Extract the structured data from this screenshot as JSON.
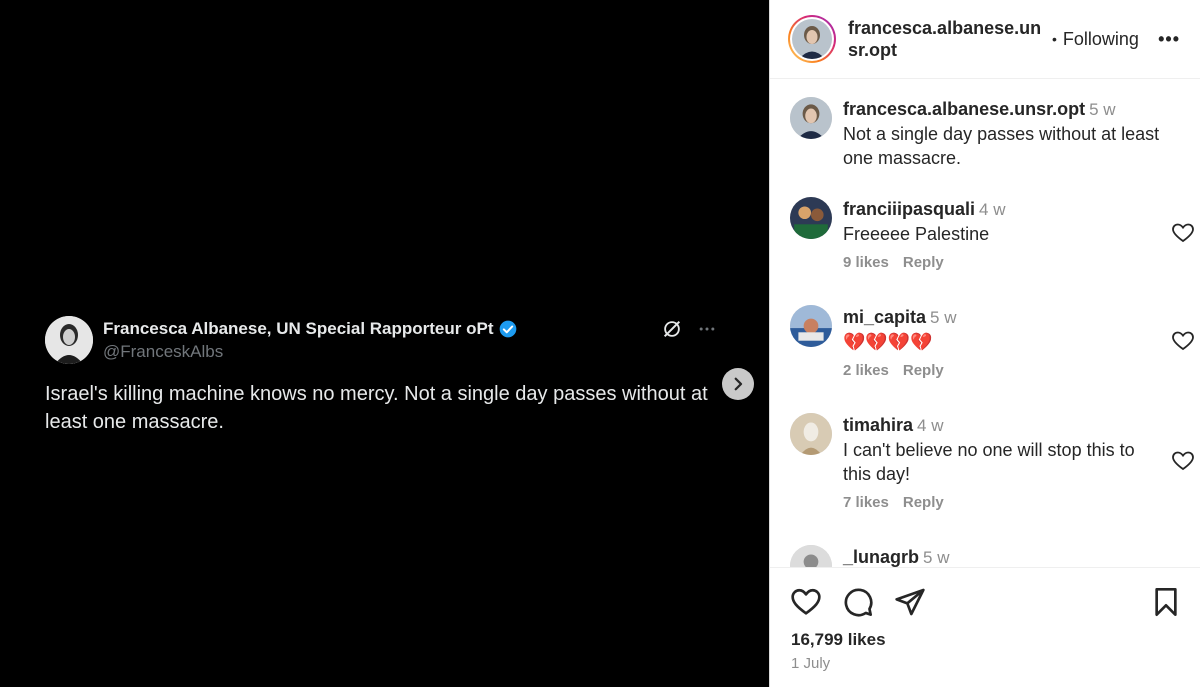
{
  "media": {
    "tweet": {
      "name": "Francesca Albanese, UN Special Rapporteur oPt",
      "handle": "@FranceskAlbs",
      "text": "Israel's killing machine knows no mercy. Not a single day passes without at least one massacre."
    },
    "next_icon": "chevron-right-icon"
  },
  "header": {
    "username": "francesca.albanese.unsr.opt",
    "separator": "•",
    "follow_label": "Following",
    "more_label": "•••"
  },
  "caption": {
    "username": "francesca.albanese.unsr.opt",
    "time": "5 w",
    "text": "Not a single day passes without at least one massacre."
  },
  "comments": [
    {
      "username": "franciiipasquali",
      "time": "4 w",
      "text": "Freeeee Palestine",
      "likes": "9 likes",
      "reply": "Reply"
    },
    {
      "username": "mi_capita",
      "time": "5 w",
      "text": "💔💔💔💔",
      "likes": "2 likes",
      "reply": "Reply"
    },
    {
      "username": "timahira",
      "time": "4 w",
      "text": "I can't believe no one will stop this to this day!",
      "likes": "7 likes",
      "reply": "Reply"
    },
    {
      "username": "_lunagrb",
      "time": "5 w"
    }
  ],
  "footer": {
    "likes": "16,799 likes",
    "date": "1 July"
  },
  "colors": {
    "media_bg": "#000000",
    "verified": "#1d9bf0",
    "muted": "#8e8e8e",
    "text": "#262626"
  }
}
